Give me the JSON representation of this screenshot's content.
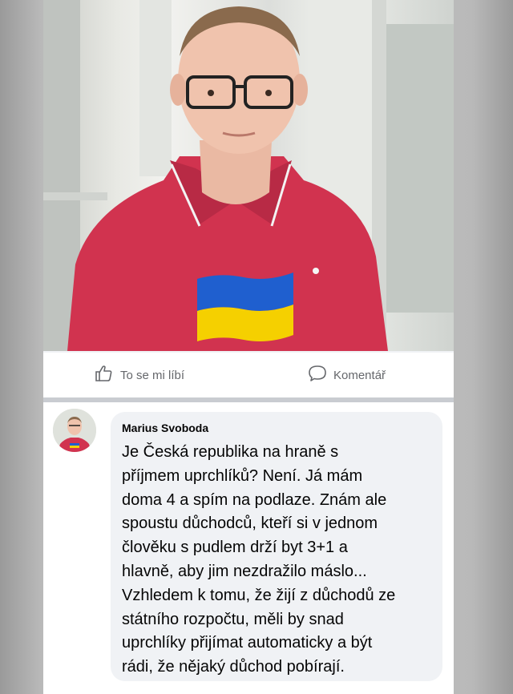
{
  "post": {
    "photo_alt": "",
    "actions": {
      "like_label": "To se mi líbí",
      "comment_label": "Komentář"
    }
  },
  "comment": {
    "author": "Marius Svoboda",
    "text": "Je Česká republika na hraně s\npříjmem uprchlíků? Není. Já mám\ndoma 4 a spím na podlaze. Znám ale\nspoustu důchodců, kteří si v jednom\nčlověku s pudlem drží byt 3+1 a\nhlavně, aby jim nezdražilo máslo...\nVzhledem k tomu, že žijí z důchodů ze\nstátního rozpočtu, měli by snad\nuprchlíky přijímat automaticky a být\nrádi, že nějaký důchod pobírají."
  },
  "colors": {
    "shirt": "#d1334f",
    "flag_blue": "#1f5fcf",
    "flag_yellow": "#f5d000",
    "icon_gray": "#65676b"
  },
  "icons": {
    "like": "thumbs-up-icon",
    "comment": "speech-bubble-icon"
  }
}
